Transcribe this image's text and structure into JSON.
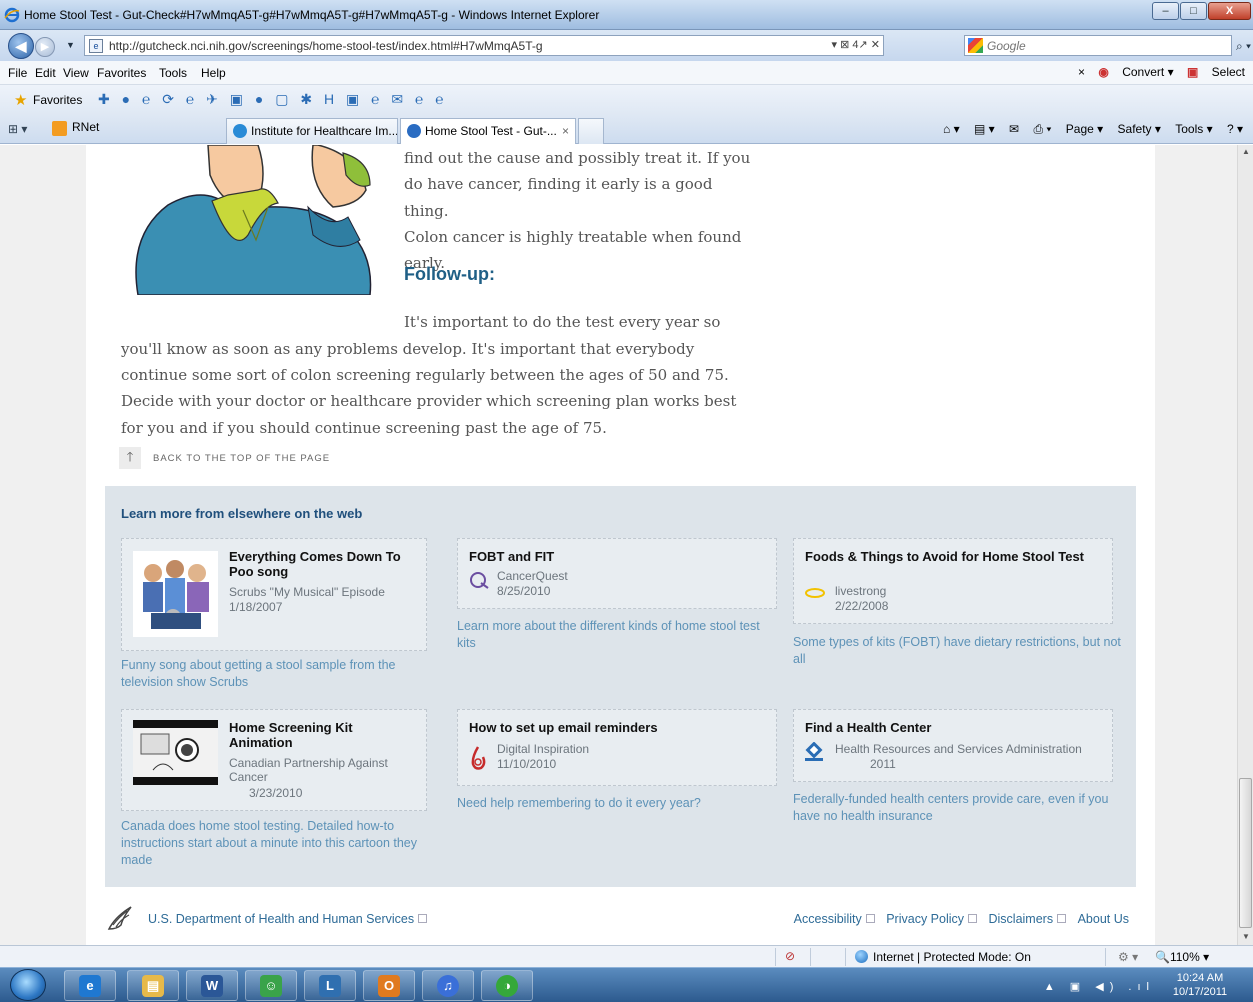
{
  "window": {
    "title": "Home Stool Test - Gut-Check#H7wMmqA5T-g#H7wMmqA5T-g#H7wMmqA5T-g - Windows Internet Explorer",
    "min_label": "–",
    "max_label": "□",
    "close_label": "X"
  },
  "addressbar": {
    "url": "http://gutcheck.nci.nih.gov/screenings/home-stool-test/index.html#H7wMmqA5T-g",
    "url_tools": "▾ ⊠ 4↗ ✕",
    "search_placeholder": "Google",
    "search_go": "⌕ ▾"
  },
  "menubar": {
    "items": [
      "File",
      "Edit",
      "View",
      "Favorites",
      "Tools",
      "Help"
    ],
    "convert_label": "Convert",
    "select_label": "Select",
    "close_x": "×"
  },
  "favorites": {
    "label": "Favorites"
  },
  "tabs": {
    "quicktabs": "⊞ ▾",
    "rnet_label": "RNet",
    "items": [
      {
        "label": "Institute for Healthcare Im...",
        "icon_color": "#2a8bd6"
      },
      {
        "label": "Home Stool Test - Gut-...",
        "icon_color": "#2a6cc2"
      }
    ],
    "close_glyph": "×",
    "commands": {
      "home": "⌂ ▾",
      "feeds": "▤ ▾",
      "mail": "✉",
      "print": "⎙ ▾",
      "page": "Page ▾",
      "safety": "Safety ▾",
      "tools": "Tools ▾",
      "help": "? ▾"
    }
  },
  "article": {
    "para1_lines": [
      "find out the cause and possibly treat it. If you",
      "do have cancer, finding it early is a good thing.",
      "Colon cancer is highly treatable when found",
      "early."
    ],
    "followup_heading": "Follow-up:",
    "para2_first_line": "It's important to do the test every year so",
    "para2_lines": [
      "you'll know as soon as any problems develop. It's important that everybody",
      "continue some sort of colon screening regularly between the ages of 50 and 75.",
      "Decide with your doctor or healthcare provider which screening plan works best",
      "for you and if you should continue screening past the age of 75."
    ],
    "back_to_top": "BACK TO THE TOP OF THE PAGE"
  },
  "learn_more": {
    "title": "Learn more from elsewhere on the web",
    "resources": [
      {
        "title": "Everything Comes Down To Poo song",
        "source": "Scrubs \"My Musical\" Episode",
        "date": "1/18/2007",
        "description": "Funny song about getting a stool sample from the television show Scrubs",
        "icon": "video-thumbnail"
      },
      {
        "title": "FOBT and FIT",
        "source": "CancerQuest",
        "date": "8/25/2010",
        "description": "Learn more about the different kinds of home stool test kits",
        "icon": "cancerquest-logo"
      },
      {
        "title": "Foods & Things to Avoid for Home Stool Test",
        "source": "livestrong",
        "date": "2/22/2008",
        "description": "Some types of kits (FOBT) have dietary restrictions, but not all",
        "icon": "livestrong-logo"
      },
      {
        "title": "Home Screening Kit Animation",
        "source": "Canadian Partnership Against Cancer",
        "date": "3/23/2010",
        "description": "Canada does home stool testing. Detailed how-to instructions start about a minute into this cartoon they made",
        "icon": "video-thumbnail"
      },
      {
        "title": "How to set up email reminders",
        "source": "Digital Inspiration",
        "date": "11/10/2010",
        "description": "Need help remembering to do it every year?",
        "icon": "digital-inspiration-logo"
      },
      {
        "title": "Find a Health Center",
        "source": "Health Resources and Services Administration",
        "date": "2011",
        "description": "Federally-funded health centers provide care, even if you have no health insurance",
        "icon": "hrsa-logo"
      }
    ]
  },
  "footer": {
    "hhs_link": "U.S. Department of Health and Human Services",
    "links": [
      "Accessibility",
      "Privacy Policy",
      "Disclaimers",
      "About Us"
    ]
  },
  "statusbar": {
    "zone": "Internet | Protected Mode: On",
    "zoom": "🔍110% ▾",
    "addon": "⚙ ▾"
  },
  "taskbar": {
    "apps": [
      {
        "name": "internet-explorer",
        "glyph": "e",
        "color": "#1f78d1"
      },
      {
        "name": "file-explorer",
        "glyph": "▤",
        "color": "#e6b94a"
      },
      {
        "name": "word",
        "glyph": "W",
        "color": "#2b5797"
      },
      {
        "name": "people",
        "glyph": "☺",
        "color": "#3aa34a"
      },
      {
        "name": "remote-desktop",
        "glyph": "L",
        "color": "#2f6fb0"
      },
      {
        "name": "outlook",
        "glyph": "O",
        "color": "#e07a1f"
      },
      {
        "name": "itunes",
        "glyph": "♫",
        "color": "#3a6fd8"
      },
      {
        "name": "browser-globe",
        "glyph": "◑",
        "color": "#35a83a"
      }
    ],
    "tray_icons": "▲ ▣ ◀) .ıl",
    "time": "10:24 AM",
    "date": "10/17/2011"
  }
}
